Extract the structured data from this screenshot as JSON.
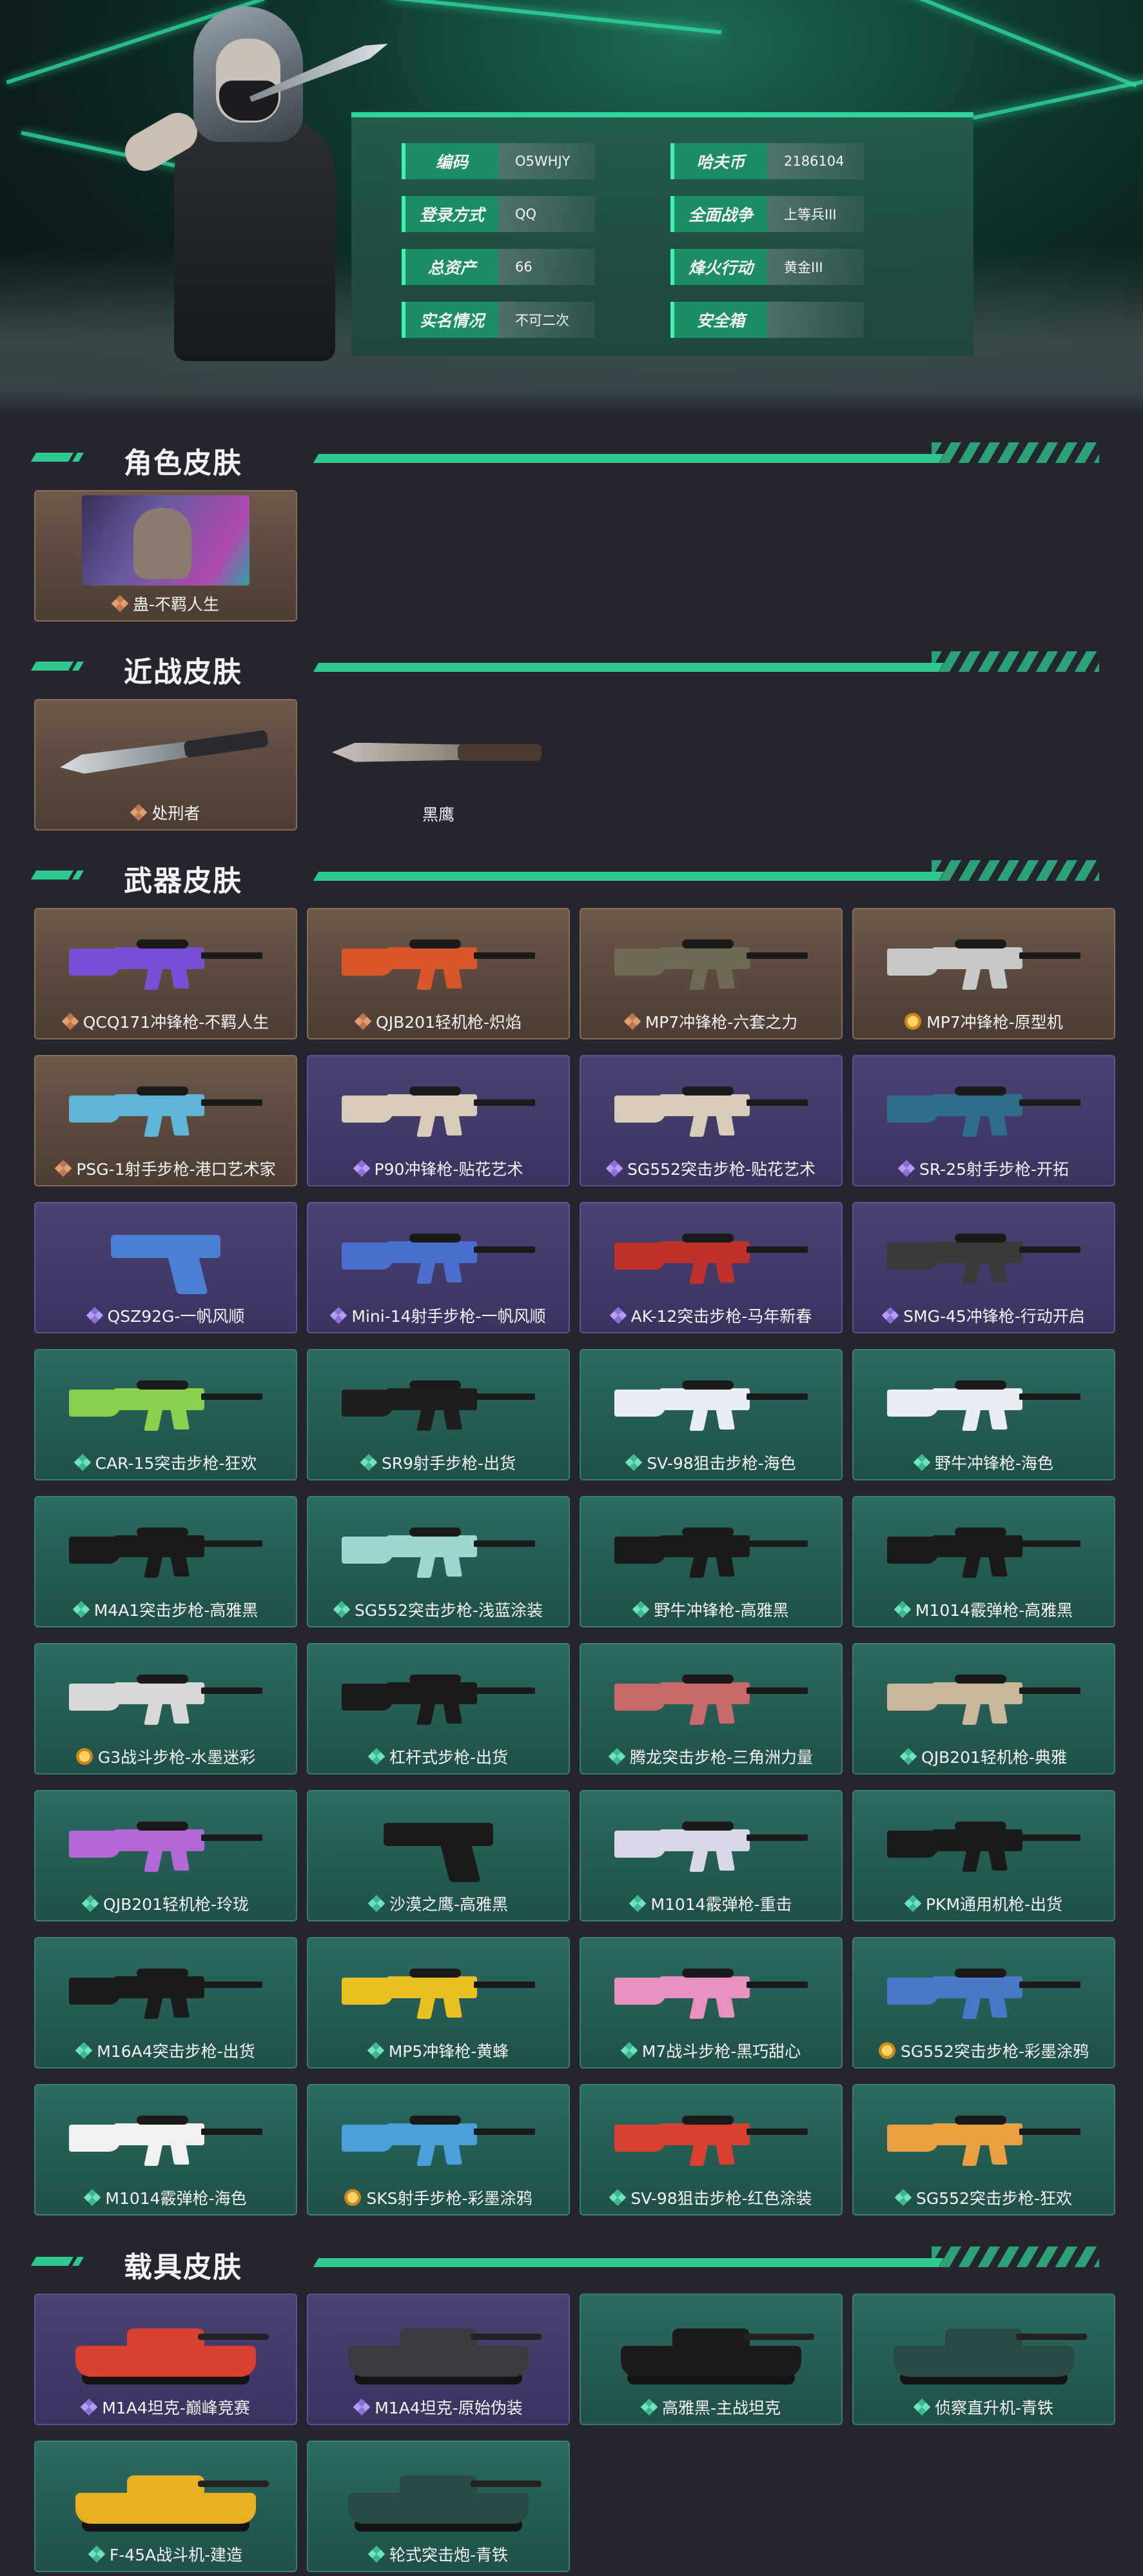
{
  "account": {
    "fields": [
      {
        "label": "编码",
        "value": "O5WHJY"
      },
      {
        "label": "哈夫币",
        "value": "2186104"
      },
      {
        "label": "登录方式",
        "value": "QQ"
      },
      {
        "label": "全面战争",
        "value": "上等兵III"
      },
      {
        "label": "总资产",
        "value": "66"
      },
      {
        "label": "烽火行动",
        "value": "黄金III"
      },
      {
        "label": "实名情况",
        "value": "不可二次"
      },
      {
        "label": "安全箱",
        "value": ""
      }
    ]
  },
  "sections": {
    "character": {
      "title": "角色皮肤",
      "items": [
        {
          "name": "蛊-不羁人生",
          "rarity": "gold",
          "kind": "portrait"
        }
      ]
    },
    "melee": {
      "title": "近战皮肤",
      "items": [
        {
          "name": "处刑者",
          "rarity": "gold",
          "kind": "knife"
        },
        {
          "name": "黑鹰",
          "rarity": "none",
          "kind": "knife"
        }
      ]
    },
    "weapons": {
      "title": "武器皮肤",
      "items": [
        {
          "name": "QCQ171冲锋枪-不羁人生",
          "rarity": "gold",
          "color": "#7a4fd8"
        },
        {
          "name": "QJB201轻机枪-炽焰",
          "rarity": "gold",
          "color": "#d8562a"
        },
        {
          "name": "MP7冲锋枪-六套之力",
          "rarity": "gold",
          "color": "#6f6a55"
        },
        {
          "name": "MP7冲锋枪-原型机",
          "rarity": "gold",
          "color": "#c8c8c8",
          "medal": true
        },
        {
          "name": "PSG-1射手步枪-港口艺术家",
          "rarity": "gold",
          "color": "#5fb5d8"
        },
        {
          "name": "P90冲锋枪-贴花艺术",
          "rarity": "purple",
          "color": "#d8cbb8"
        },
        {
          "name": "SG552突击步枪-贴花艺术",
          "rarity": "purple",
          "color": "#d8cbb8"
        },
        {
          "name": "SR-25射手步枪-开拓",
          "rarity": "purple",
          "color": "#2f6e8a"
        },
        {
          "name": "QSZ92G-一帆风顺",
          "rarity": "purple",
          "color": "#4b7fd6",
          "kind": "pistol"
        },
        {
          "name": "Mini-14射手步枪-一帆风顺",
          "rarity": "purple",
          "color": "#4b6fd0"
        },
        {
          "name": "AK-12突击步枪-马年新春",
          "rarity": "purple",
          "color": "#c0302a"
        },
        {
          "name": "SMG-45冲锋枪-行动开启",
          "rarity": "purple",
          "color": "#3a3a3a"
        },
        {
          "name": "CAR-15突击步枪-狂欢",
          "rarity": "teal",
          "color": "#8ad04a"
        },
        {
          "name": "SR9射手步枪-出货",
          "rarity": "teal",
          "color": "#1e1e1e"
        },
        {
          "name": "SV-98狙击步枪-海色",
          "rarity": "teal",
          "color": "#e8eef4"
        },
        {
          "name": "野牛冲锋枪-海色",
          "rarity": "teal",
          "color": "#e8eef4"
        },
        {
          "name": "M4A1突击步枪-高雅黑",
          "rarity": "teal",
          "color": "#1a1a1a"
        },
        {
          "name": "SG552突击步枪-浅蓝涂装",
          "rarity": "teal",
          "color": "#9fd6d2"
        },
        {
          "name": "野牛冲锋枪-高雅黑",
          "rarity": "teal",
          "color": "#1a1a1a"
        },
        {
          "name": "M1014霰弹枪-高雅黑",
          "rarity": "teal",
          "color": "#1a1a1a"
        },
        {
          "name": "G3战斗步枪-水墨迷彩",
          "rarity": "teal",
          "color": "#d8d8d8",
          "medal": true
        },
        {
          "name": "杠杆式步枪-出货",
          "rarity": "teal",
          "color": "#1a1a1a"
        },
        {
          "name": "腾龙突击步枪-三角洲力量",
          "rarity": "teal",
          "color": "#c86a6a"
        },
        {
          "name": "QJB201轻机枪-典雅",
          "rarity": "teal",
          "color": "#c8b898"
        },
        {
          "name": "QJB201轻机枪-玲珑",
          "rarity": "teal",
          "color": "#b468d8"
        },
        {
          "name": "沙漠之鹰-高雅黑",
          "rarity": "teal",
          "color": "#1a1a1a",
          "kind": "pistol"
        },
        {
          "name": "M1014霰弹枪-重击",
          "rarity": "teal",
          "color": "#d8d8e8"
        },
        {
          "name": "PKM通用机枪-出货",
          "rarity": "teal",
          "color": "#1a1a1a"
        },
        {
          "name": "M16A4突击步枪-出货",
          "rarity": "teal",
          "color": "#1a1a1a"
        },
        {
          "name": "MP5冲锋枪-黄蜂",
          "rarity": "teal",
          "color": "#e8c020"
        },
        {
          "name": "M7战斗步枪-黑巧甜心",
          "rarity": "teal",
          "color": "#e890c0"
        },
        {
          "name": "SG552突击步枪-彩墨涂鸦",
          "rarity": "teal",
          "color": "#4a78c8",
          "medal": true
        },
        {
          "name": "M1014霰弹枪-海色",
          "rarity": "teal",
          "color": "#f0f0f0"
        },
        {
          "name": "SKS射手步枪-彩墨涂鸦",
          "rarity": "teal",
          "color": "#4aa0d8",
          "medal": true
        },
        {
          "name": "SV-98狙击步枪-红色涂装",
          "rarity": "teal",
          "color": "#d84030"
        },
        {
          "name": "SG552突击步枪-狂欢",
          "rarity": "teal",
          "color": "#e8a040"
        }
      ]
    },
    "vehicles": {
      "title": "载具皮肤",
      "items": [
        {
          "name": "M1A4坦克-巅峰竞赛",
          "rarity": "purple",
          "color": "#d84030"
        },
        {
          "name": "M1A4坦克-原始伪装",
          "rarity": "purple",
          "color": "#3a3a40"
        },
        {
          "name": "高雅黑-主战坦克",
          "rarity": "teal",
          "color": "#1a1a1a"
        },
        {
          "name": "侦察直升机-青铁",
          "rarity": "teal",
          "color": "#2a4a48"
        },
        {
          "name": "F-45A战斗机-建造",
          "rarity": "teal",
          "color": "#e8b020"
        },
        {
          "name": "轮式突击炮-青铁",
          "rarity": "teal",
          "color": "#2a4a48"
        }
      ]
    }
  }
}
